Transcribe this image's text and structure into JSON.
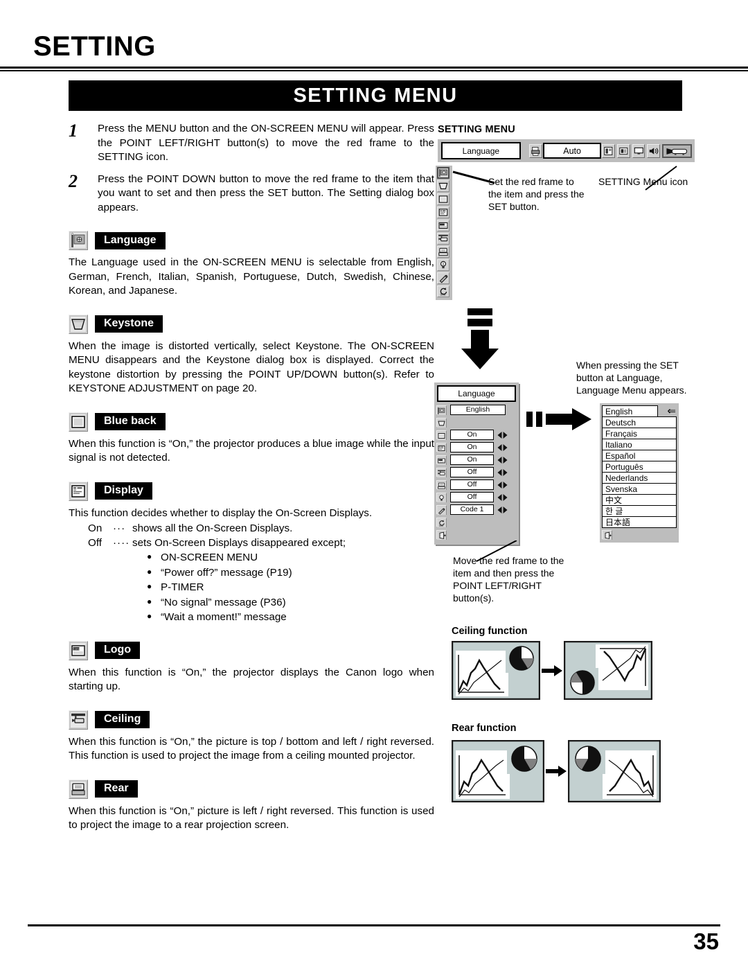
{
  "header": {
    "chapter_title": "SETTING",
    "banner_title": "SETTING MENU"
  },
  "steps": [
    {
      "num": "1",
      "text": "Press the MENU button and the ON-SCREEN MENU will appear.  Press the POINT LEFT/RIGHT button(s) to move the red frame to  the SETTING icon."
    },
    {
      "num": "2",
      "text": "Press the POINT DOWN button to move the red frame to the item that you want to set and then press the SET button.  The Setting dialog box appears."
    }
  ],
  "sections": [
    {
      "icon": "language-flag-icon",
      "label": "Language",
      "body": "The Language used in the ON-SCREEN MENU is selectable from English, German, French, Italian, Spanish, Portuguese, Dutch, Swedish, Chinese, Korean, and Japanese."
    },
    {
      "icon": "keystone-trapezoid-icon",
      "label": "Keystone",
      "body": "When the image is distorted vertically, select Keystone.  The ON-SCREEN MENU disappears and the Keystone dialog box is displayed.  Correct the keystone distortion by pressing the POINT UP/DOWN button(s).   Refer to KEYSTONE ADJUSTMENT on page 20."
    },
    {
      "icon": "blue-back-screen-icon",
      "label": "Blue back",
      "body": "When this function is “On,” the projector produces a blue image while the input signal is not detected."
    },
    {
      "icon": "display-osd-icon",
      "label": "Display",
      "body": "This function decides whether to display the On-Screen Displays."
    },
    {
      "icon": "logo-canon-icon",
      "label": "Logo",
      "body": "When this function is “On,” the projector displays the Canon logo when starting up."
    },
    {
      "icon": "ceiling-mount-icon",
      "label": "Ceiling",
      "body": "When this function is “On,” the picture is top / bottom and left / right reversed.  This function is used to project the image from a ceiling mounted projector."
    },
    {
      "icon": "rear-projection-icon",
      "label": "Rear",
      "body": "When this function is “On,” picture is left / right reversed.  This function is used to project the image to a rear projection screen."
    }
  ],
  "display_options": {
    "on_key": "On",
    "on_dots": "···",
    "on_text": "shows all the On-Screen Displays.",
    "off_key": "Off",
    "off_dots": "····",
    "off_text": "sets On-Screen Displays disappeared except;",
    "bullets": [
      "ON-SCREEN MENU",
      "“Power off?” message (P19)",
      "P-TIMER",
      "“No signal” message (P36)",
      "“Wait a moment!” message"
    ]
  },
  "menu_mock": {
    "title": "SETTING MENU",
    "language_label": "Language",
    "auto_label": "Auto",
    "top_icons": [
      "printer-icon",
      "system-icon",
      "image-adjust-icon",
      "picture-screen-icon",
      "sound-speaker-icon",
      "setting-projector-icon"
    ],
    "selected_top_icon": "setting-projector-icon",
    "side_icons": [
      "language-flag-icon",
      "keystone-trapezoid-icon",
      "blue-back-screen-icon",
      "display-osd-icon",
      "logo-canon-icon",
      "ceiling-mount-icon",
      "rear-projection-icon",
      "lamp-icon",
      "remote-control-icon"
    ],
    "selected_side_icon": "language-flag-icon",
    "callout_frame": "Set the red frame to the item and press the SET button.",
    "callout_menu_icon": "SETTING Menu icon"
  },
  "language_dialog": {
    "title": "Language",
    "rows": [
      {
        "icon": "language-flag-icon",
        "value": "English",
        "arrows": false
      },
      {
        "icon": "keystone-trapezoid-icon",
        "value": "",
        "arrows": false
      },
      {
        "icon": "blue-back-screen-icon",
        "value": "On",
        "arrows": true
      },
      {
        "icon": "display-osd-icon",
        "value": "On",
        "arrows": true
      },
      {
        "icon": "logo-canon-icon",
        "value": "On",
        "arrows": true
      },
      {
        "icon": "ceiling-mount-icon",
        "value": "Off",
        "arrows": true
      },
      {
        "icon": "rear-projection-icon",
        "value": "Off",
        "arrows": true
      },
      {
        "icon": "lamp-icon",
        "value": "Off",
        "arrows": true
      },
      {
        "icon": "remote-control-icon",
        "value": "Code 1",
        "arrows": true
      },
      {
        "icon": "reset-icon",
        "value": "",
        "arrows": false
      },
      {
        "icon": "quit-exit-icon",
        "value": "",
        "arrows": false
      }
    ],
    "callout": "Move the red frame to the item and then press the POINT LEFT/RIGHT button(s).",
    "set_callout": "When pressing the SET button at Language, Language Menu appears."
  },
  "language_list": {
    "items": [
      "English",
      "Deutsch",
      "Français",
      "Italiano",
      "Español",
      "Português",
      "Nederlands",
      "Svenska",
      "中文",
      "한 글",
      "日本語"
    ],
    "selected": "English",
    "cursor_glyph": "⇐",
    "exit_icon": "quit-exit-icon"
  },
  "figures": {
    "ceiling_title": "Ceiling function",
    "rear_title": "Rear function",
    "arrow_glyph": "➤"
  },
  "footer": {
    "page_number": "35"
  },
  "colors": {
    "panel_gray": "#bdbdbd",
    "icon_gray": "#c8c8c8",
    "figure_gray": "#c3d0d0",
    "ink": "#000000"
  }
}
